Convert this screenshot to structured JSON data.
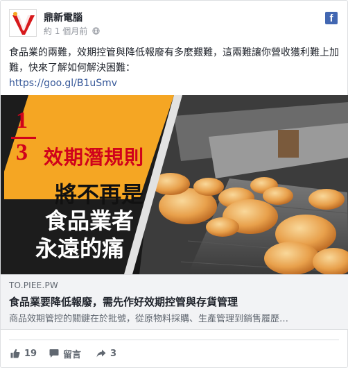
{
  "page": {
    "name": "鼎新電腦",
    "time": "約 1 個月前"
  },
  "post": {
    "text": "食品業的兩難，效期控管與降低報廢有多麼艱難，這兩難讓你營收獲利難上加難，快來了解如何解決困難：",
    "link": "https://goo.gl/B1uSmv"
  },
  "image": {
    "fraction_top": "1",
    "fraction_bottom": "3",
    "headline": "效期潛規則",
    "lines": [
      "將不再是",
      "食品業者",
      "永遠的痛"
    ]
  },
  "link_preview": {
    "domain": "TO.PIEE.PW",
    "title": "食品業要降低報廢，需先作好效期控管與存貨管理",
    "description": "商品效期管控的關鍵在於批號，從原物料採購、生產管理到銷售履歷…"
  },
  "actions": {
    "like_count": "19",
    "comment_label": "留言",
    "share_count": "3"
  },
  "colors": {
    "facebook_blue": "#4267b2",
    "link_blue": "#365899",
    "banner_yellow": "#f5a623",
    "banner_red": "#d0021b"
  }
}
